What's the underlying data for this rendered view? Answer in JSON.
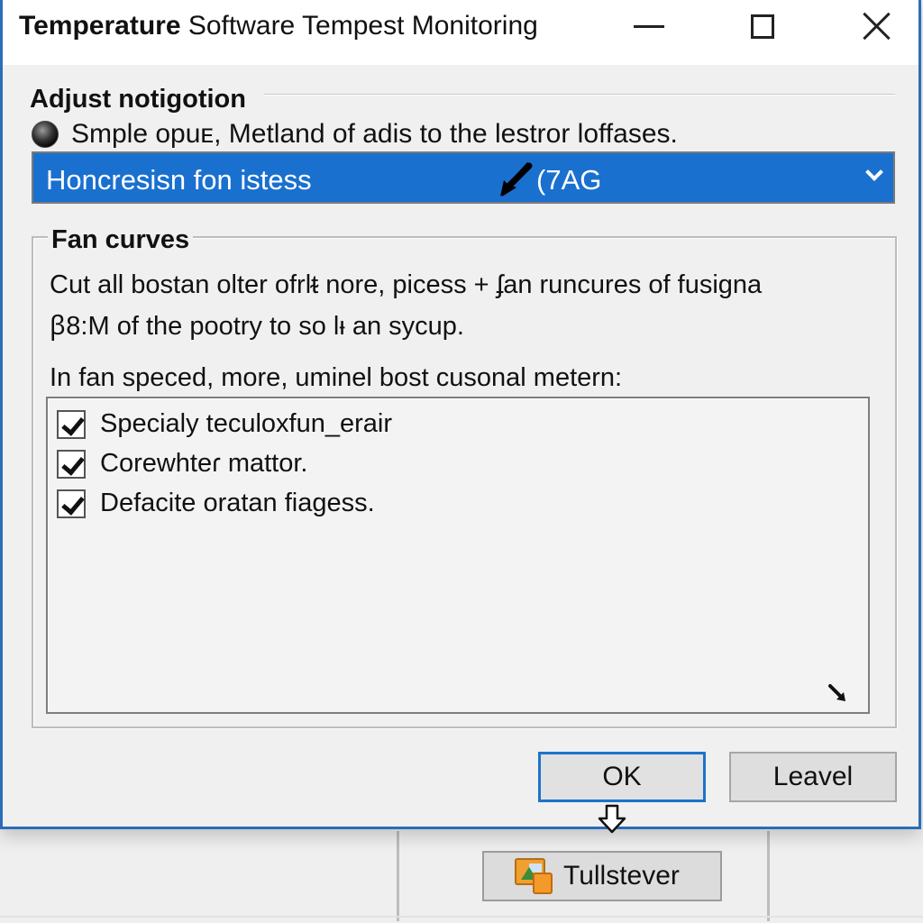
{
  "window": {
    "title_bold": "Temperature",
    "title_rest": " Software Tempest Monitoring",
    "controls": {
      "minimize_icon": "minimize-icon",
      "maximize_icon": "maximize-icon",
      "close_icon": "close-icon"
    }
  },
  "adjust": {
    "section_title": "Adjust notigotion",
    "radio_label": "Smple opuᴇ, Metland of adis to the lestror loffases.",
    "radio_selected": true,
    "dropdown": {
      "value": "Honcresisn fon istess",
      "extra": "(7AG",
      "chevron_icon": "chevron-down-icon"
    }
  },
  "fan_curves": {
    "group_title": "Fan curves",
    "description": [
      "Cut all bostan olter ofrlᵵ nore, picess +  ʄan runcures of fusigna",
      "ꞵ8:M of the pootry to so lᵻ an sycup."
    ],
    "list_label": "In fan speced, more, uminel bost cusonal metern:",
    "items": [
      {
        "label": "Specialy teculoxfun_erair",
        "checked": true
      },
      {
        "label": "Corewhteɾ mattor.",
        "checked": true
      },
      {
        "label": "Defacite oratan fiagess.",
        "checked": true
      }
    ]
  },
  "buttons": {
    "ok": "OK",
    "cancel": "Leavel"
  },
  "taskbar": {
    "button_label": "Tullstever",
    "icon": "image-app-icon"
  },
  "colors": {
    "accent": "#1a70cf",
    "window_border": "#2a6db8",
    "ok_border": "#1e73c8"
  }
}
